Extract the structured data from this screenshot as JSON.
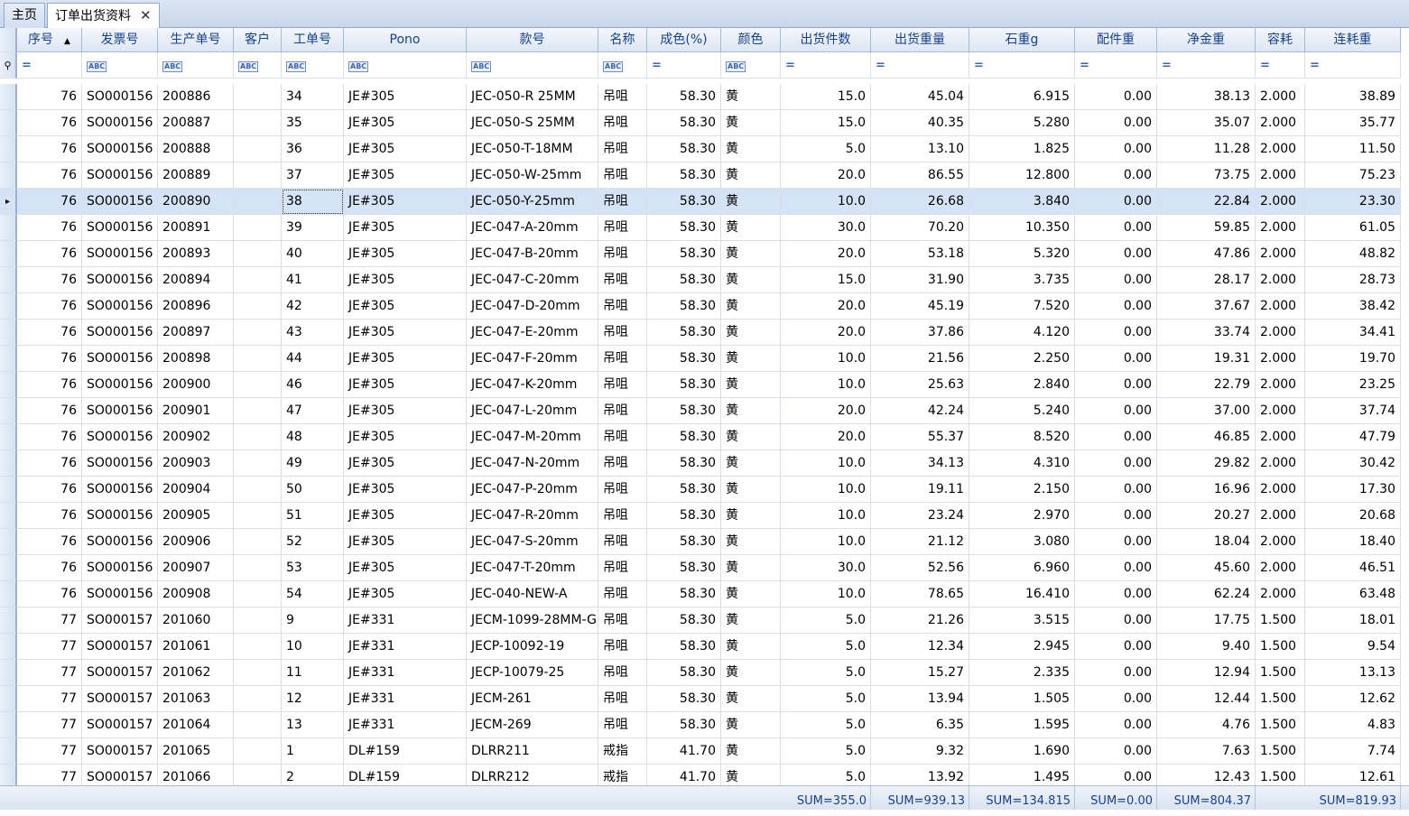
{
  "tabs": [
    {
      "label": "主页"
    },
    {
      "label": "订单出货资料",
      "close": "✕"
    }
  ],
  "columns": [
    "序号",
    "发票号",
    "生产单号",
    "客户",
    "工单号",
    "Pono",
    "款号",
    "名称",
    "成色(%)",
    "颜色",
    "出货件数",
    "出货重量",
    "石重g",
    "配件重",
    "净金重",
    "容耗",
    "连耗重"
  ],
  "sort_indicator": "▲",
  "filter": {
    "text_icon": "ABC",
    "eq_icon": "="
  },
  "rows": [
    [
      "76",
      "SO000156",
      "200886",
      "",
      "34",
      "JE#305",
      "JEC-050-R 25MM",
      "吊咀",
      "58.30",
      "黄",
      "15.0",
      "45.04",
      "6.915",
      "0.00",
      "38.13",
      "2.000",
      "38.89"
    ],
    [
      "76",
      "SO000156",
      "200887",
      "",
      "35",
      "JE#305",
      "JEC-050-S 25MM",
      "吊咀",
      "58.30",
      "黄",
      "15.0",
      "40.35",
      "5.280",
      "0.00",
      "35.07",
      "2.000",
      "35.77"
    ],
    [
      "76",
      "SO000156",
      "200888",
      "",
      "36",
      "JE#305",
      "JEC-050-T-18MM",
      "吊咀",
      "58.30",
      "黄",
      "5.0",
      "13.10",
      "1.825",
      "0.00",
      "11.28",
      "2.000",
      "11.50"
    ],
    [
      "76",
      "SO000156",
      "200889",
      "",
      "37",
      "JE#305",
      "JEC-050-W-25mm",
      "吊咀",
      "58.30",
      "黄",
      "20.0",
      "86.55",
      "12.800",
      "0.00",
      "73.75",
      "2.000",
      "75.23"
    ],
    [
      "76",
      "SO000156",
      "200890",
      "",
      "38",
      "JE#305",
      "JEC-050-Y-25mm",
      "吊咀",
      "58.30",
      "黄",
      "10.0",
      "26.68",
      "3.840",
      "0.00",
      "22.84",
      "2.000",
      "23.30"
    ],
    [
      "76",
      "SO000156",
      "200891",
      "",
      "39",
      "JE#305",
      "JEC-047-A-20mm",
      "吊咀",
      "58.30",
      "黄",
      "30.0",
      "70.20",
      "10.350",
      "0.00",
      "59.85",
      "2.000",
      "61.05"
    ],
    [
      "76",
      "SO000156",
      "200893",
      "",
      "40",
      "JE#305",
      "JEC-047-B-20mm",
      "吊咀",
      "58.30",
      "黄",
      "20.0",
      "53.18",
      "5.320",
      "0.00",
      "47.86",
      "2.000",
      "48.82"
    ],
    [
      "76",
      "SO000156",
      "200894",
      "",
      "41",
      "JE#305",
      "JEC-047-C-20mm",
      "吊咀",
      "58.30",
      "黄",
      "15.0",
      "31.90",
      "3.735",
      "0.00",
      "28.17",
      "2.000",
      "28.73"
    ],
    [
      "76",
      "SO000156",
      "200896",
      "",
      "42",
      "JE#305",
      "JEC-047-D-20mm",
      "吊咀",
      "58.30",
      "黄",
      "20.0",
      "45.19",
      "7.520",
      "0.00",
      "37.67",
      "2.000",
      "38.42"
    ],
    [
      "76",
      "SO000156",
      "200897",
      "",
      "43",
      "JE#305",
      "JEC-047-E-20mm",
      "吊咀",
      "58.30",
      "黄",
      "20.0",
      "37.86",
      "4.120",
      "0.00",
      "33.74",
      "2.000",
      "34.41"
    ],
    [
      "76",
      "SO000156",
      "200898",
      "",
      "44",
      "JE#305",
      "JEC-047-F-20mm",
      "吊咀",
      "58.30",
      "黄",
      "10.0",
      "21.56",
      "2.250",
      "0.00",
      "19.31",
      "2.000",
      "19.70"
    ],
    [
      "76",
      "SO000156",
      "200900",
      "",
      "46",
      "JE#305",
      "JEC-047-K-20mm",
      "吊咀",
      "58.30",
      "黄",
      "10.0",
      "25.63",
      "2.840",
      "0.00",
      "22.79",
      "2.000",
      "23.25"
    ],
    [
      "76",
      "SO000156",
      "200901",
      "",
      "47",
      "JE#305",
      "JEC-047-L-20mm",
      "吊咀",
      "58.30",
      "黄",
      "20.0",
      "42.24",
      "5.240",
      "0.00",
      "37.00",
      "2.000",
      "37.74"
    ],
    [
      "76",
      "SO000156",
      "200902",
      "",
      "48",
      "JE#305",
      "JEC-047-M-20mm",
      "吊咀",
      "58.30",
      "黄",
      "20.0",
      "55.37",
      "8.520",
      "0.00",
      "46.85",
      "2.000",
      "47.79"
    ],
    [
      "76",
      "SO000156",
      "200903",
      "",
      "49",
      "JE#305",
      "JEC-047-N-20mm",
      "吊咀",
      "58.30",
      "黄",
      "10.0",
      "34.13",
      "4.310",
      "0.00",
      "29.82",
      "2.000",
      "30.42"
    ],
    [
      "76",
      "SO000156",
      "200904",
      "",
      "50",
      "JE#305",
      "JEC-047-P-20mm",
      "吊咀",
      "58.30",
      "黄",
      "10.0",
      "19.11",
      "2.150",
      "0.00",
      "16.96",
      "2.000",
      "17.30"
    ],
    [
      "76",
      "SO000156",
      "200905",
      "",
      "51",
      "JE#305",
      "JEC-047-R-20mm",
      "吊咀",
      "58.30",
      "黄",
      "10.0",
      "23.24",
      "2.970",
      "0.00",
      "20.27",
      "2.000",
      "20.68"
    ],
    [
      "76",
      "SO000156",
      "200906",
      "",
      "52",
      "JE#305",
      "JEC-047-S-20mm",
      "吊咀",
      "58.30",
      "黄",
      "10.0",
      "21.12",
      "3.080",
      "0.00",
      "18.04",
      "2.000",
      "18.40"
    ],
    [
      "76",
      "SO000156",
      "200907",
      "",
      "53",
      "JE#305",
      "JEC-047-T-20mm",
      "吊咀",
      "58.30",
      "黄",
      "30.0",
      "52.56",
      "6.960",
      "0.00",
      "45.60",
      "2.000",
      "46.51"
    ],
    [
      "76",
      "SO000156",
      "200908",
      "",
      "54",
      "JE#305",
      "JEC-040-NEW-A",
      "吊咀",
      "58.30",
      "黄",
      "10.0",
      "78.65",
      "16.410",
      "0.00",
      "62.24",
      "2.000",
      "63.48"
    ],
    [
      "77",
      "SO000157",
      "201060",
      "",
      "9",
      "JE#331",
      "JECM-1099-28MM-G",
      "吊咀",
      "58.30",
      "黄",
      "5.0",
      "21.26",
      "3.515",
      "0.00",
      "17.75",
      "1.500",
      "18.01"
    ],
    [
      "77",
      "SO000157",
      "201061",
      "",
      "10",
      "JE#331",
      "JECP-10092-19",
      "吊咀",
      "58.30",
      "黄",
      "5.0",
      "12.34",
      "2.945",
      "0.00",
      "9.40",
      "1.500",
      "9.54"
    ],
    [
      "77",
      "SO000157",
      "201062",
      "",
      "11",
      "JE#331",
      "JECP-10079-25",
      "吊咀",
      "58.30",
      "黄",
      "5.0",
      "15.27",
      "2.335",
      "0.00",
      "12.94",
      "1.500",
      "13.13"
    ],
    [
      "77",
      "SO000157",
      "201063",
      "",
      "12",
      "JE#331",
      "JECM-261",
      "吊咀",
      "58.30",
      "黄",
      "5.0",
      "13.94",
      "1.505",
      "0.00",
      "12.44",
      "1.500",
      "12.62"
    ],
    [
      "77",
      "SO000157",
      "201064",
      "",
      "13",
      "JE#331",
      "JECM-269",
      "吊咀",
      "58.30",
      "黄",
      "5.0",
      "6.35",
      "1.595",
      "0.00",
      "4.76",
      "1.500",
      "4.83"
    ],
    [
      "77",
      "SO000157",
      "201065",
      "",
      "1",
      "DL#159",
      "DLRR211",
      "戒指",
      "41.70",
      "黄",
      "5.0",
      "9.32",
      "1.690",
      "0.00",
      "7.63",
      "1.500",
      "7.74"
    ],
    [
      "77",
      "SO000157",
      "201066",
      "",
      "2",
      "DL#159",
      "DLRR212",
      "戒指",
      "41.70",
      "黄",
      "5.0",
      "13.92",
      "1.495",
      "0.00",
      "12.43",
      "1.500",
      "12.61"
    ]
  ],
  "selected_row": 4,
  "footer": {
    "sum_pieces": "SUM=355.0",
    "sum_weight": "SUM=939.13",
    "sum_stone": "SUM=134.815",
    "sum_parts": "SUM=0.00",
    "sum_net": "SUM=804.37",
    "sum_loss_weight": "SUM=819.93"
  }
}
